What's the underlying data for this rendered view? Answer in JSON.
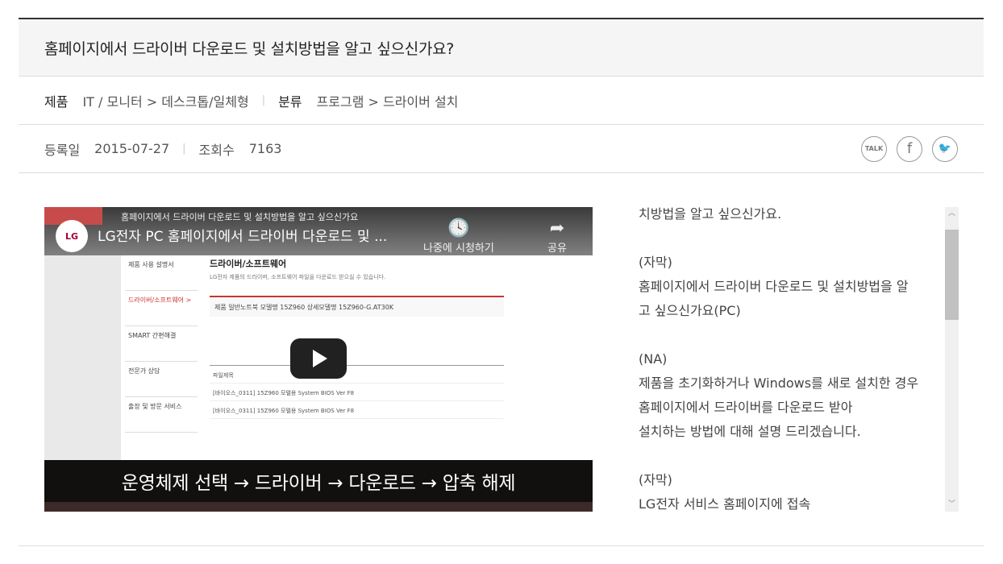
{
  "page": {
    "title": "홈페이지에서 드라이버 다운로드 및 설치방법을 알고 싶으신가요?"
  },
  "category": {
    "product_label": "제품",
    "product_path": "IT / 모니터 > 데스크톱/일체형",
    "class_label": "분류",
    "class_path": "프로그램 > 드라이버 설치"
  },
  "info": {
    "date_label": "등록일",
    "date": "2015-07-27",
    "views_label": "조회수",
    "views": "7163"
  },
  "share": {
    "talk": "TALK",
    "facebook": "f",
    "twitter": "🐦"
  },
  "video": {
    "logo": "LG",
    "title": "LG전자 PC 홈페이지에서 드라이버 다운로드 및 ...",
    "watch_later": "나중에 시청하기",
    "share": "공유",
    "site_heading": "홈페이지에서 드라이버 다운로드 및 설치방법을 알고 싶으신가요",
    "caption": "운영체제 선택 → 드라이버 → 다운로드 → 압축 해제",
    "page_heading": "드라이버/소프트웨어",
    "page_desc": "LG전자 제품의 드라이버, 소프트웨어 파일을 다운로드 받으실 수 있습니다.",
    "info_row": "제품   일반노트북    모델명   15Z960   상세모델명   15Z960-G.AT30K",
    "side": [
      "제품 사용 설명서",
      "드라이버/소프트웨어 >",
      "SMART 간편해결",
      "전문가 상담",
      "출장 및 방문 서비스"
    ],
    "rows": [
      "파일제목",
      "[바이오스_0311] 15Z960 모텔용 System BIOS Ver F8",
      "[바이오스_0311] 15Z960 모텔용 System BIOS Ver F8"
    ]
  },
  "transcript": {
    "text": "치방법을 알고 싶으신가요.\n\n(자막)\n홈페이지에서 드라이버 다운로드 및 설치방법을 알\n고 싶으신가요(PC)\n\n(NA)\n제품을 초기화하거나 Windows를 새로 설치한 경우\n홈페이지에서 드라이버를 다운로드 받아\n설치하는 방법에 대해 설명 드리겠습니다.\n\n(자막)\nLG전자 서비스 홈페이지에 접속"
  }
}
